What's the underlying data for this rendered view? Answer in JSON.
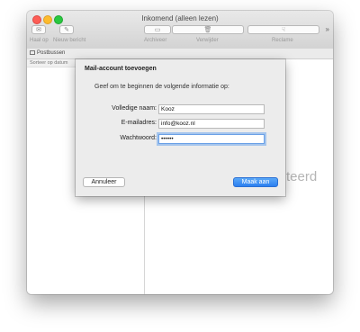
{
  "window": {
    "title": "Inkomend (alleen lezen)"
  },
  "toolbar": {
    "fetch_mail": "Haal op",
    "new_message": "Nieuw bericht",
    "archive": "Archiveer",
    "delete": "Verwijder",
    "junk": "Reclame",
    "overflow": "»"
  },
  "subbar": {
    "mailboxes": "Postbussen"
  },
  "message_list": {
    "sort_label": "Sorteer op datum"
  },
  "reader": {
    "empty_text_fragment": "teerd"
  },
  "dialog": {
    "title": "Mail-account toevoegen",
    "subtitle": "Geef om te beginnen de volgende informatie op:",
    "fields": {
      "full_name_label": "Volledige naam:",
      "full_name_value": "Kooz",
      "email_label": "E-mailadres:",
      "email_value": "info@kooz.nl",
      "password_label": "Wachtwoord:",
      "password_value": "••••••"
    },
    "cancel_button": "Annuleer",
    "create_button": "Maak aan"
  }
}
